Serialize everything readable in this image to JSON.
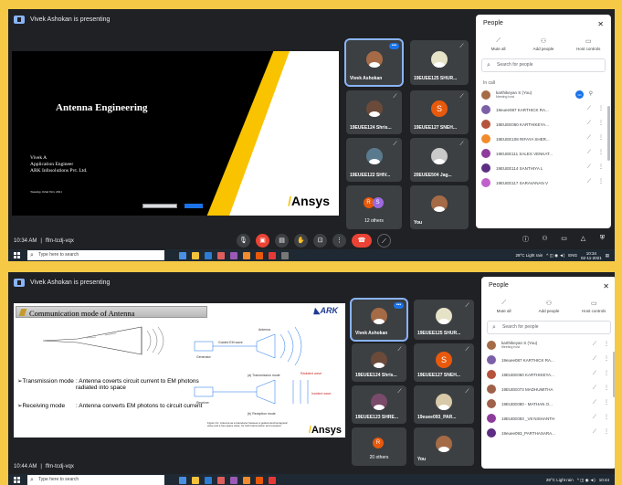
{
  "screenshots": [
    {
      "presenting_banner": "Vivek Ashokan is presenting",
      "slide": {
        "title": "Antenna Engineering",
        "presenter_lines": [
          "Vivek A",
          "Application Engineer",
          "ARK Infosolutions Pvt. Ltd."
        ],
        "date": "Tuesday, 02nd Nov 2021",
        "logo": "Ansys"
      },
      "tiles": [
        {
          "name": "Vivek Ashokan",
          "kind": "photo"
        },
        {
          "name": "19EUEE125 SHUR...",
          "kind": "photo"
        },
        {
          "name": "19EUEE124 Shris...",
          "kind": "photo"
        },
        {
          "name": "19EUEE127 SNEH...",
          "kind": "letter",
          "letter": "S"
        },
        {
          "name": "19EUEE122 SHIV...",
          "kind": "photo"
        },
        {
          "name": "20EUEE504 Jag...",
          "kind": "photo"
        },
        {
          "name": "12 others",
          "kind": "others",
          "letters": [
            "R",
            "S"
          ]
        },
        {
          "name": "You",
          "kind": "photo"
        }
      ],
      "bottom": {
        "time": "10:34 AM",
        "meeting_code": "ffm-tcdj-vqx"
      },
      "taskbar": {
        "search_placeholder": "Type here to search",
        "weather": "28°C Light rain",
        "lang": "ENG",
        "clock_time": "10:34",
        "clock_date": "02-11-2021"
      },
      "people": {
        "title": "People",
        "actions": [
          "Mute all",
          "Add people",
          "Host controls"
        ],
        "search_placeholder": "Search for people",
        "in_call_label": "In call",
        "rows": [
          {
            "name": "karthikeyan S (You)",
            "sub": "Meeting host",
            "color": "#a56b46"
          },
          {
            "name": "19euee087 KARTHICK RA...",
            "sub": "",
            "color": "#7b5fa8"
          },
          {
            "name": "19EUEE060 KARTHIKEYA...",
            "sub": "",
            "color": "#b5533c"
          },
          {
            "name": "19EUEE108 RIFAYA SHER...",
            "sub": "",
            "color": "#f28b2c"
          },
          {
            "name": "19EUEE111 SALES VENKAT...",
            "sub": "",
            "color": "#8e3b9c"
          },
          {
            "name": "19EUEE114 SANTHIYA L",
            "sub": "",
            "color": "#5c2d82"
          },
          {
            "name": "19EUEE117 SARAVANAN V",
            "sub": "",
            "color": "#c061cb"
          }
        ]
      }
    },
    {
      "presenting_banner": "Vivek Ashokan is presenting",
      "slide": {
        "title": "Communication mode of Antenna",
        "logo": "Ansys",
        "brand": "ARK",
        "bullets": [
          {
            "key": "➢Transmission mode",
            "val": ": Antenna coverts circuit current to EM photons radiated into space"
          },
          {
            "key": "➢Receiving mode",
            "val": ": Antenna converts EM photons to circuit current"
          }
        ],
        "diagram_labels": {
          "tx": "(a) Transmission mode",
          "rx": "(b) Reception mode",
          "generator": "Generator",
          "guided": "Guided EM wave",
          "antenna": "Antenna",
          "receiver": "Receiver",
          "radiated": "Radiated wave",
          "incident": "Incident wave"
        },
        "caption": "Figure 9.1: Antenna as a transducer between a guided electromagnetic wave and a free-space wave, for both transmission and reception."
      },
      "tiles": [
        {
          "name": "Vivek Ashokan",
          "kind": "photo"
        },
        {
          "name": "19EUEE125 SHUR...",
          "kind": "photo"
        },
        {
          "name": "19EUEE124 Shris...",
          "kind": "photo"
        },
        {
          "name": "19EUEE127 SNEH...",
          "kind": "letter",
          "letter": "S"
        },
        {
          "name": "19EUEE123 SHRE...",
          "kind": "photo"
        },
        {
          "name": "19euee093_PAR...",
          "kind": "photo"
        },
        {
          "name": "20 others",
          "kind": "others",
          "letters": [
            "R"
          ]
        },
        {
          "name": "You",
          "kind": "photo"
        }
      ],
      "bottom": {
        "time": "10:44 AM",
        "meeting_code": "ffm-tcdj-vqx"
      },
      "taskbar": {
        "search_placeholder": "Type here to search",
        "weather": "28°C Light rain",
        "clock_time": "10:44"
      },
      "people": {
        "title": "People",
        "actions": [
          "Mute all",
          "Add people",
          "Host controls"
        ],
        "search_placeholder": "Search for people",
        "rows": [
          {
            "name": "karthikeyan S (You)",
            "sub": "Meeting host",
            "color": "#a56b46"
          },
          {
            "name": "19euee087 KARTHICK RA...",
            "sub": "",
            "color": "#7b5fa8"
          },
          {
            "name": "19EUEE060 KARTHIKEYA...",
            "sub": "",
            "color": "#b5533c"
          },
          {
            "name": "19EUEE073 MADHUMITHA",
            "sub": "",
            "color": "#a0614a"
          },
          {
            "name": "19EUEE080 - MATHAN O...",
            "sub": "",
            "color": "#a0614a"
          },
          {
            "name": "19EUEE093 _V8 NISHANTH",
            "sub": "",
            "color": "#8e3b9c"
          },
          {
            "name": "19euee093_PARTHASARA...",
            "sub": "",
            "color": "#5c2d82"
          }
        ]
      }
    }
  ],
  "colors": {
    "frame": "#f5c945",
    "meet_bg": "#202124",
    "tile_bg": "#3c4043",
    "end_call": "#ea4335",
    "accent": "#1a73e8",
    "ansys_yellow": "#f9c300"
  }
}
